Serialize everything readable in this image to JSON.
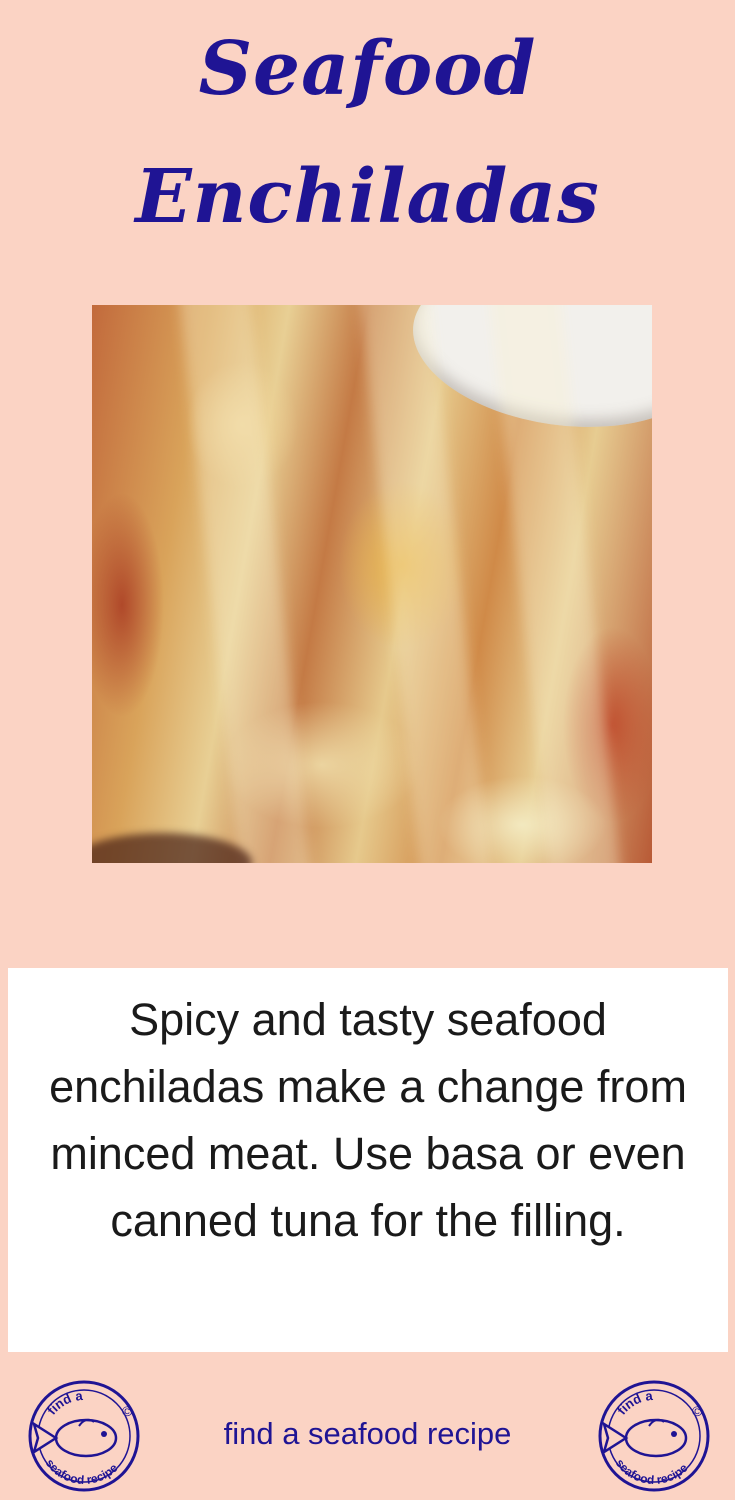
{
  "title": {
    "line1": "Seafood",
    "line2": "Enchiladas"
  },
  "description": "Spicy and tasty seafood enchiladas make a change from minced meat. Use basa or even canned tuna for the filling.",
  "footer": {
    "text": "find a seafood recipe",
    "logo_top_text": "find a",
    "logo_bottom_text": "seafood recipe",
    "logo_mark": "©"
  },
  "colors": {
    "background": "#fbd3c4",
    "title": "#1f1494",
    "text": "#1a1a1a",
    "box": "#ffffff"
  }
}
